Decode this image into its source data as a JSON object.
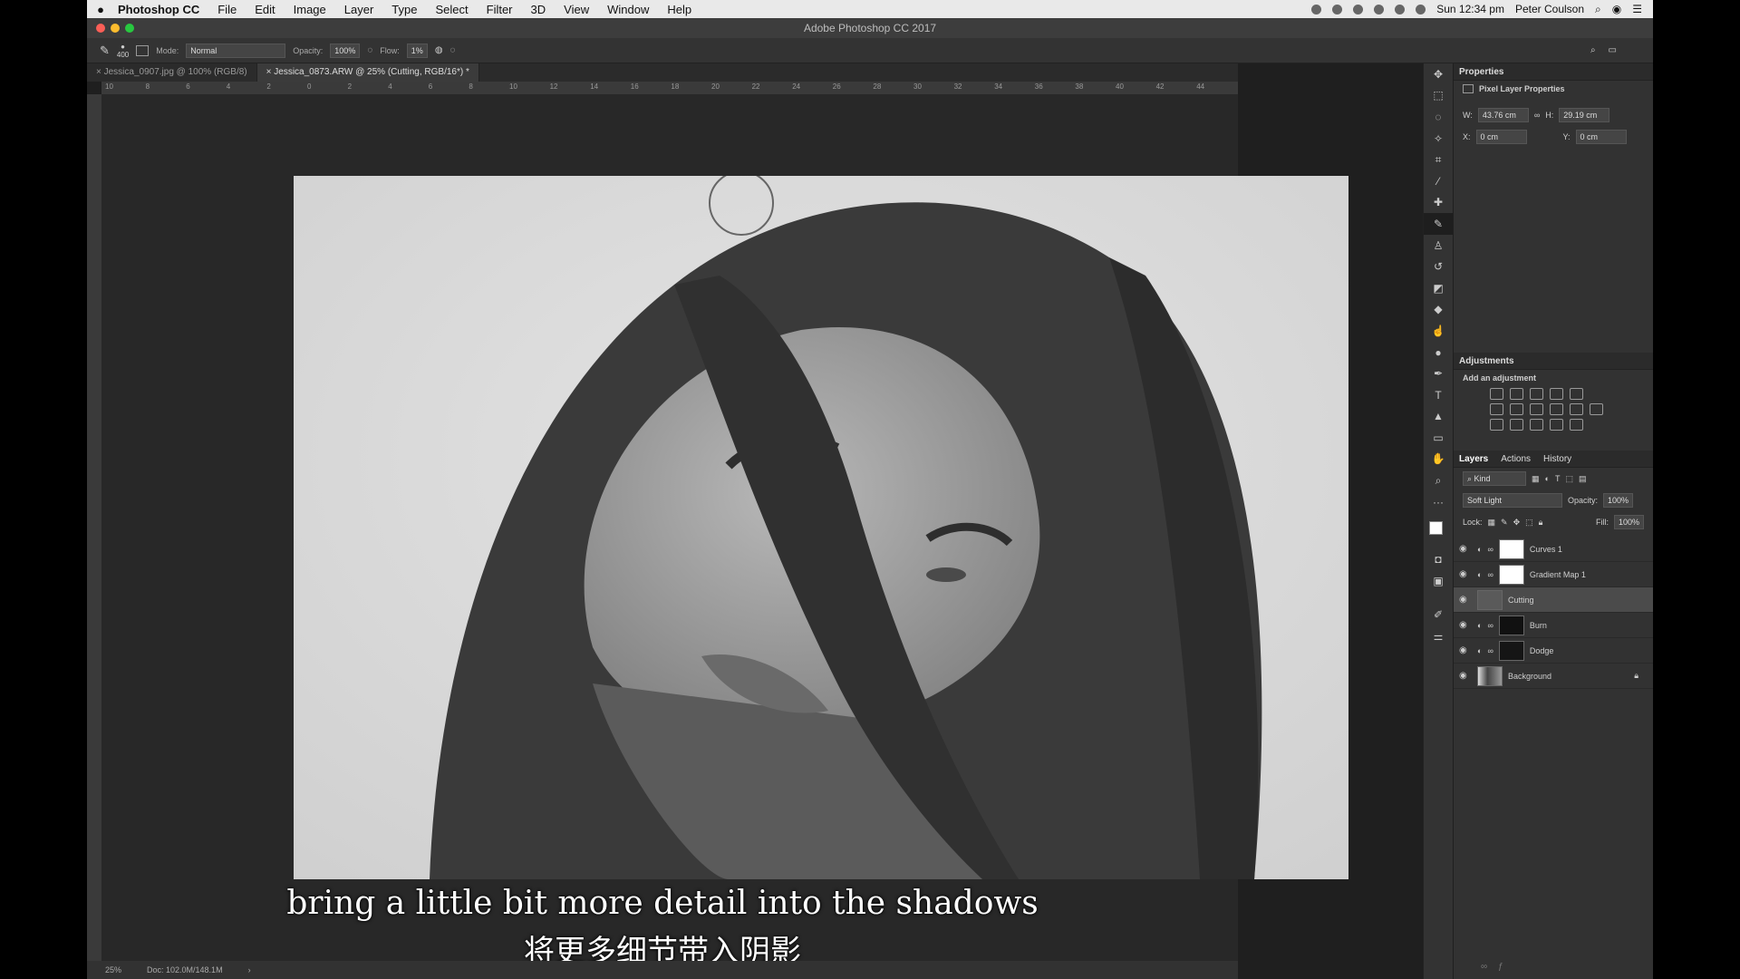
{
  "menubar": {
    "app": "Photoshop CC",
    "items": [
      "File",
      "Edit",
      "Image",
      "Layer",
      "Type",
      "Select",
      "Filter",
      "3D",
      "View",
      "Window",
      "Help"
    ],
    "clock": "Sun 12:34 pm",
    "user": "Peter Coulson"
  },
  "window": {
    "title": "Adobe Photoshop CC 2017"
  },
  "options_bar": {
    "brush_size": "400",
    "mode_label": "Mode:",
    "mode_value": "Normal",
    "opacity_label": "Opacity:",
    "opacity_value": "100%",
    "flow_label": "Flow:",
    "flow_value": "1%"
  },
  "tabs": [
    "Jessica_0907.jpg @ 100% (RGB/8)",
    "Jessica_0873.ARW @ 25% (Cutting, RGB/16*) *"
  ],
  "ruler_labels": [
    "10",
    "8",
    "6",
    "4",
    "2",
    "0",
    "2",
    "4",
    "6",
    "8",
    "10",
    "12",
    "14",
    "16",
    "18",
    "20",
    "22",
    "24",
    "26",
    "28",
    "30",
    "32",
    "34",
    "36",
    "38",
    "40",
    "42",
    "44"
  ],
  "subtitles": {
    "en": "bring a little bit more detail into the shadows",
    "zh": "将更多细节带入阴影"
  },
  "statusbar": {
    "zoom": "25%",
    "doc": "Doc: 102.0M/148.1M"
  },
  "properties": {
    "title": "Properties",
    "subtitle": "Pixel Layer Properties",
    "w_label": "W:",
    "w_value": "43.76 cm",
    "h_label": "H:",
    "h_value": "29.19 cm",
    "x_label": "X:",
    "x_value": "0 cm",
    "y_label": "Y:",
    "y_value": "0 cm"
  },
  "adjustments": {
    "title": "Adjustments",
    "subtitle": "Add an adjustment"
  },
  "layers_panel": {
    "tabs": [
      "Layers",
      "Actions",
      "History"
    ],
    "kind": "Kind",
    "blend_mode": "Soft Light",
    "opacity_label": "Opacity:",
    "opacity_value": "100%",
    "lock_label": "Lock:",
    "fill_label": "Fill:",
    "fill_value": "100%",
    "layers": [
      {
        "name": "Curves 1"
      },
      {
        "name": "Gradient Map 1"
      },
      {
        "name": "Cutting"
      },
      {
        "name": "Burn"
      },
      {
        "name": "Dodge"
      },
      {
        "name": "Background"
      }
    ]
  },
  "colors": {
    "red": "#fc5f57",
    "yellow": "#fdbc2e",
    "green": "#28c840"
  }
}
